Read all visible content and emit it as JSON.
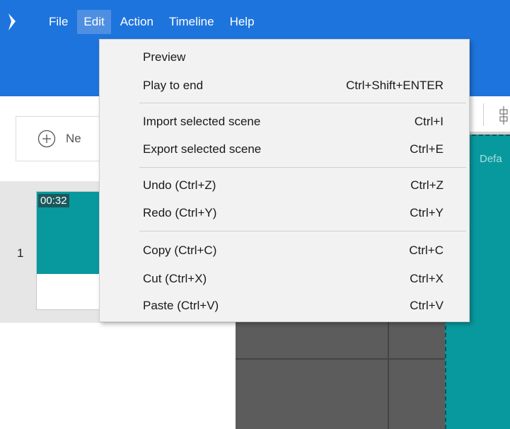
{
  "menubar": {
    "items": [
      "File",
      "Edit",
      "Action",
      "Timeline",
      "Help"
    ],
    "active": "Edit"
  },
  "toolbar": {
    "new_button_label": "Ne"
  },
  "scenes": {
    "items": [
      {
        "index": "1",
        "duration": "00:32"
      }
    ]
  },
  "canvas": {
    "label": "Defa"
  },
  "edit_menu": {
    "groups": [
      [
        {
          "label": "Preview",
          "shortcut": ""
        },
        {
          "label": "Play to end",
          "shortcut": "Ctrl+Shift+ENTER"
        }
      ],
      [
        {
          "label": "Import selected scene",
          "shortcut": "Ctrl+I"
        },
        {
          "label": "Export selected scene",
          "shortcut": "Ctrl+E"
        }
      ],
      [
        {
          "label": "Undo (Ctrl+Z)",
          "shortcut": "Ctrl+Z"
        },
        {
          "label": "Redo (Ctrl+Y)",
          "shortcut": "Ctrl+Y"
        }
      ],
      [
        {
          "label": "Copy (Ctrl+C)",
          "shortcut": "Ctrl+C"
        },
        {
          "label": "Cut (Ctrl+X)",
          "shortcut": "Ctrl+X"
        },
        {
          "label": "Paste (Ctrl+V)",
          "shortcut": "Ctrl+V"
        }
      ]
    ]
  },
  "colors": {
    "appbar": "#1e74dd",
    "menu_active": "#4f8fe1",
    "scene_teal": "#08999e",
    "menu_bg": "#f2f2f2"
  }
}
